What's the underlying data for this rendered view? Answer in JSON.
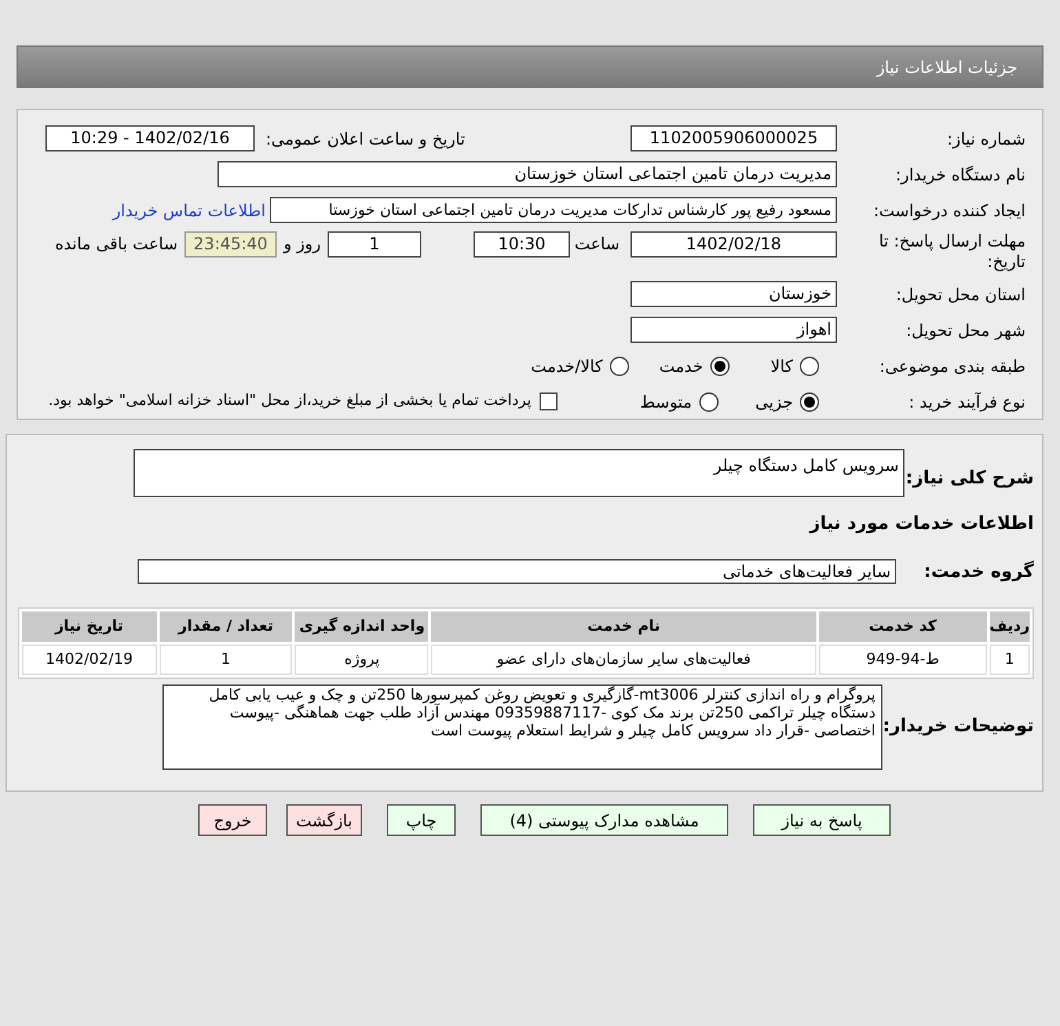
{
  "header": {
    "title": "جزئیات اطلاعات نیاز"
  },
  "details": {
    "need_number": {
      "label": "شماره نیاز:",
      "value": "1102005906000025"
    },
    "announce": {
      "label": "تاریخ و ساعت اعلان عمومی:",
      "value": "1402/02/16 - 10:29"
    },
    "buyer_org": {
      "label": "نام دستگاه خریدار:",
      "value": "مدیریت درمان تامین اجتماعی استان خوزستان"
    },
    "requester": {
      "label": "ایجاد کننده درخواست:",
      "value": "مسعود رفیع پور کارشناس تدارکات مدیریت درمان تامین اجتماعی استان خوزستا",
      "link": "اطلاعات تماس خریدار"
    },
    "deadline": {
      "label": "مهلت ارسال پاسخ: تا تاریخ:",
      "date": "1402/02/18",
      "time_label": "ساعت",
      "time": "10:30",
      "days": "1",
      "days_label": "روز و",
      "remaining": "23:45:40",
      "remaining_label": "ساعت باقی مانده"
    },
    "province": {
      "label": "استان محل تحویل:",
      "value": "خوزستان"
    },
    "city": {
      "label": "شهر محل تحویل:",
      "value": "اهواز"
    },
    "category": {
      "label": "طبقه بندی موضوعی:",
      "options": [
        {
          "label": "کالا",
          "selected": false
        },
        {
          "label": "خدمت",
          "selected": true
        },
        {
          "label": "کالا/خدمت",
          "selected": false
        }
      ]
    },
    "process": {
      "label": "نوع فرآیند خرید :",
      "options": [
        {
          "label": "جزیی",
          "selected": true
        },
        {
          "label": "متوسط",
          "selected": false
        }
      ],
      "payment": {
        "label": "پرداخت تمام یا بخشی از مبلغ خرید،از محل \"اسناد خزانه اسلامی\" خواهد بود.",
        "checked": false
      }
    }
  },
  "summary": {
    "label": "شرح کلی نیاز:",
    "value": "سرویس کامل دستگاه چیلر"
  },
  "services_heading": "اطلاعات خدمات مورد نیاز",
  "service_group": {
    "label": "گروه خدمت:",
    "value": "سایر فعالیت‌های خدماتی"
  },
  "table": {
    "columns": [
      "ردیف",
      "کد خدمت",
      "نام خدمت",
      "واحد اندازه گیری",
      "تعداد / مقدار",
      "تاریخ نیاز"
    ],
    "rows": [
      [
        "1",
        "ط-94-949",
        "فعالیت‌های سایر سازمان‌های دارای عضو",
        "پروژه",
        "1",
        "1402/02/19"
      ]
    ]
  },
  "buyer_notes": {
    "label": "توضیحات خریدار:",
    "value": "پروگرام و راه اندازی کنترلر mt3006-گازگیری و تعویض روغن کمپرسورها 250تن و چک و عیب یابی کامل دستگاه چیلر تراکمی 250تن برند مک کوی -09359887117 مهندس آزاد طلب جهت هماهنگی -پیوست اختصاصی -قرار داد سرویس کامل چیلر و شرایط استعلام پیوست است"
  },
  "buttons": [
    {
      "label": "پاسخ به نیاز",
      "kind": "normal"
    },
    {
      "label": "مشاهده مدارک پیوستی (4)",
      "kind": "normal"
    },
    {
      "label": "چاپ",
      "kind": "normal"
    },
    {
      "label": "بازگشت",
      "kind": "danger"
    },
    {
      "label": "خروج",
      "kind": "danger"
    }
  ]
}
